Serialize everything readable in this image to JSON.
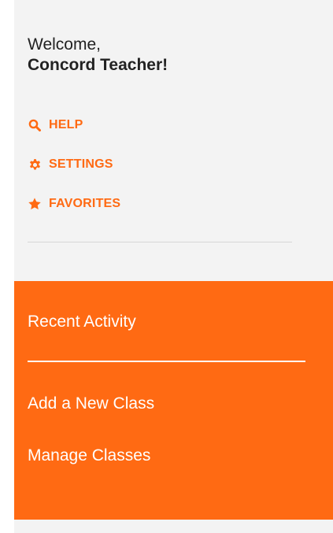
{
  "welcome": {
    "greeting": "Welcome,",
    "name": "Concord Teacher!"
  },
  "quick_links": [
    {
      "label": "HELP",
      "icon": "search-icon"
    },
    {
      "label": "SETTINGS",
      "icon": "gear-icon"
    },
    {
      "label": "FAVORITES",
      "icon": "star-icon"
    }
  ],
  "nav": {
    "recent_activity": "Recent Activity",
    "add_class": "Add a New Class",
    "manage_classes": "Manage Classes"
  },
  "colors": {
    "accent": "#ff6a13",
    "sidebar_bg": "#f3f3f3",
    "text_dark": "#222222"
  }
}
